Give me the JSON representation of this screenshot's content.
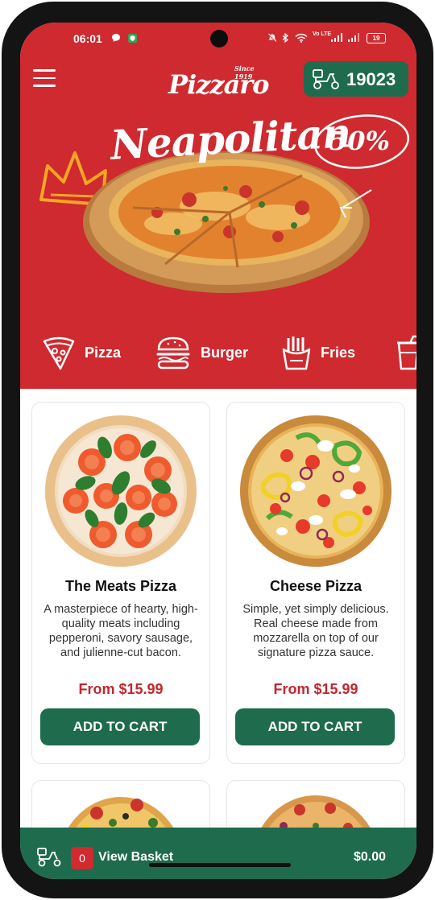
{
  "status_bar": {
    "time": "06:01",
    "network": "Vo LTE",
    "battery": "19"
  },
  "header": {
    "logo": "Pizzaro",
    "logo_tagline": "Since 1919",
    "hotline_number": "19023",
    "menu_icon": "hamburger-menu-icon",
    "hotline_icon": "delivery-scooter-icon"
  },
  "banner": {
    "title": "Neapolitan",
    "discount": "50%"
  },
  "categories": [
    {
      "label": "Pizza",
      "icon": "pizza-slice-icon"
    },
    {
      "label": "Burger",
      "icon": "burger-icon"
    },
    {
      "label": "Fries",
      "icon": "fries-icon"
    },
    {
      "label": "",
      "icon": "drink-cup-icon"
    }
  ],
  "products": [
    {
      "name": "The Meats Pizza",
      "description": "A masterpiece of hearty, high-quality meats including pepperoni, savory sausage, and julienne-cut bacon.",
      "price": "From $15.99",
      "button_label": "ADD TO CART"
    },
    {
      "name": "Cheese Pizza",
      "description": "Simple, yet simply delicious. Real cheese made from mozzarella on top of our signature pizza sauce.",
      "price": "From $15.99",
      "button_label": "ADD TO CART"
    }
  ],
  "basket": {
    "count": "0",
    "label": "View Basket",
    "total": "$0.00"
  },
  "colors": {
    "brand_red": "#ce2a2f",
    "brand_green": "#1e6b4d",
    "price_red": "#c2272d"
  }
}
